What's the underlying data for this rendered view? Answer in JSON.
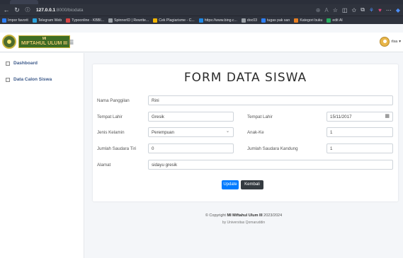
{
  "browser": {
    "url_host": "127.0.0.1",
    "url_path": ":8000/biodata",
    "bookmarks": [
      {
        "label": "Impor favorit",
        "color": "#2d7ff9"
      },
      {
        "label": "Telegram Web",
        "color": "#2aa3de"
      },
      {
        "label": "Typoonline - KBBI...",
        "color": "#d64545"
      },
      {
        "label": "SpinnerID | Rewrite...",
        "color": "#9aa0a6"
      },
      {
        "label": "Cek Plagiarisme - C...",
        "color": "#f2b500"
      },
      {
        "label": "https://www.bing.c...",
        "color": "#1e88e5"
      },
      {
        "label": "doc03",
        "color": "#9aa0a6"
      },
      {
        "label": "tugas pak san",
        "color": "#2d7ff9"
      },
      {
        "label": "Kategori buku",
        "color": "#e67e22"
      },
      {
        "label": "edit AI",
        "color": "#27ae60"
      }
    ]
  },
  "navbar": {
    "logo_line1": "MI",
    "logo_line2": "MIFTAHUL ULUM III",
    "user_name": "rlsa"
  },
  "sidebar": {
    "items": [
      {
        "label": "Dashboard"
      },
      {
        "label": "Data Calon Siswa"
      }
    ]
  },
  "form": {
    "title": "FORM DATA SISWA",
    "nama_panggilan": {
      "label": "Nama Panggilan",
      "value": "Rini"
    },
    "tempat_lahir": {
      "label": "Tempat Lahir",
      "value": "Gresik"
    },
    "tanggal_lahir": {
      "label": "Tempat Lahir",
      "value": "15/11/2017"
    },
    "jenis_kelamin": {
      "label": "Jenis Kelamin",
      "value": "Perempuan"
    },
    "anak_ke": {
      "label": "Anak-Ke",
      "value": "1"
    },
    "saudara_tiri": {
      "label": "Jumlah Saudara Tiri",
      "value": "0"
    },
    "saudara_kandung": {
      "label": "Jumlah Saudara Kandung",
      "value": "1"
    },
    "alamat": {
      "label": "Alamat",
      "value": "sidayu gresik"
    },
    "update_label": "Update",
    "kembali_label": "Kembali"
  },
  "footer": {
    "copyright_prefix": "© Copyright",
    "school": "MI Miftahul Ulum III",
    "year": "2023/2024",
    "by": "by Universitas Qomaruddin"
  }
}
